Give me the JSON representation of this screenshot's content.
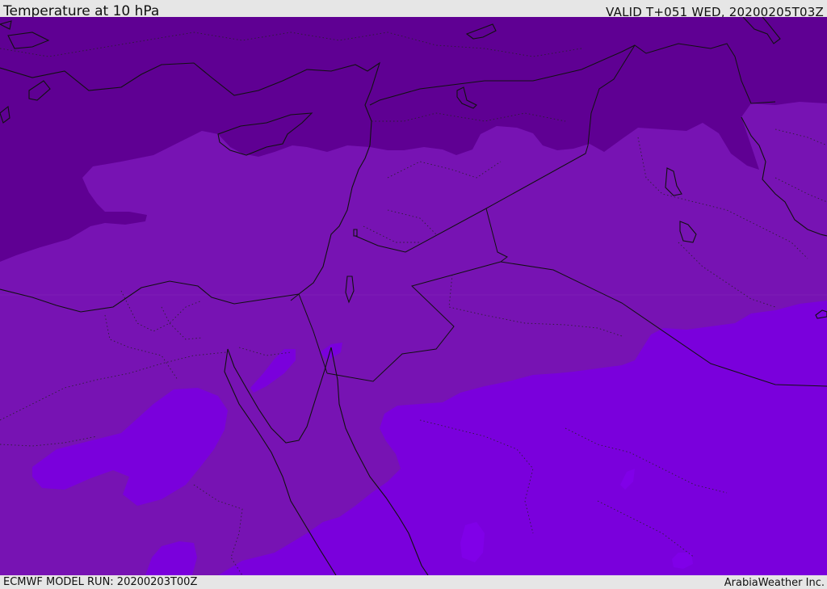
{
  "header": {
    "title": "Temperature at 10 hPa",
    "valid_time": "VALID T+051 WED, 20200205T03Z"
  },
  "footer": {
    "model_run": "ECMWF MODEL RUN: 20200203T00Z",
    "credit": "ArabiaWeather Inc."
  },
  "colors": {
    "band_coldest": "#5f0093",
    "band_middle": "#7713b3",
    "band_warm": "#7a00dc",
    "band_warmest": "#7f00e6",
    "coastline": "#111111",
    "frame_background": "#e6e6e6"
  }
}
